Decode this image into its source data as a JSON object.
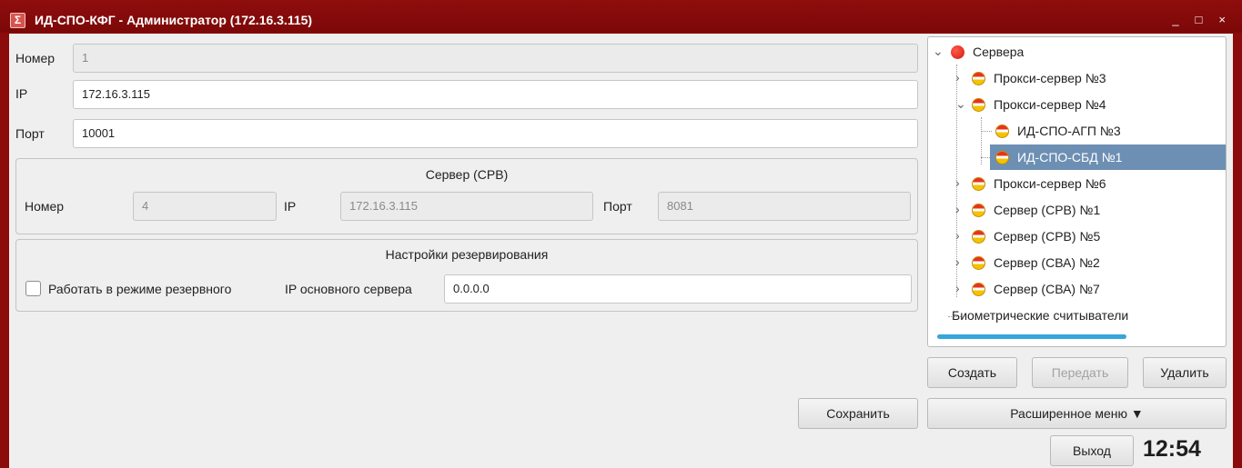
{
  "window": {
    "title": "ИД-СПО-КФГ - Администратор  (172.16.3.115)",
    "minimize": "_",
    "maximize": "□",
    "close": "×"
  },
  "form": {
    "number_label": "Номер",
    "number_value": "1",
    "ip_label": "IP",
    "ip_value": "172.16.3.115",
    "port_label": "Порт",
    "port_value": "10001"
  },
  "server_group": {
    "title": "Сервер (СРВ)",
    "number_label": "Номер",
    "number_value": "4",
    "ip_label": "IP",
    "ip_value": "172.16.3.115",
    "port_label": "Порт",
    "port_value": "8081"
  },
  "reserve_group": {
    "title": "Настройки резервирования",
    "checkbox_label": "Работать в режиме резервного",
    "checkbox_checked": false,
    "main_ip_label": "IP основного сервера",
    "main_ip_value": "0.0.0.0"
  },
  "tree": {
    "items": [
      {
        "label": "Сервера",
        "icon": "red-circle-icon",
        "expanded": true
      },
      {
        "label": "Прокси-сервер №3",
        "icon": "server-status-icon",
        "expanded": false
      },
      {
        "label": "Прокси-сервер №4",
        "icon": "server-status-icon",
        "expanded": true
      },
      {
        "label": "ИД-СПО-АГП №3",
        "icon": "server-status-icon"
      },
      {
        "label": "ИД-СПО-СБД №1",
        "icon": "server-status-icon",
        "selected": true
      },
      {
        "label": "Прокси-сервер №6",
        "icon": "server-status-icon",
        "expanded": false
      },
      {
        "label": "Сервер (СРВ) №1",
        "icon": "server-status-icon",
        "expanded": false
      },
      {
        "label": "Сервер (СРВ) №5",
        "icon": "server-status-icon",
        "expanded": false
      },
      {
        "label": "Сервер (СВА) №2",
        "icon": "server-status-icon",
        "expanded": false
      },
      {
        "label": "Сервер (СВА) №7",
        "icon": "server-status-icon",
        "expanded": false
      },
      {
        "label": "Биометрические считыватели"
      }
    ]
  },
  "buttons": {
    "create": "Создать",
    "send": "Передать",
    "delete": "Удалить",
    "save": "Сохранить",
    "advanced_menu": "Расширенное меню ▼",
    "exit": "Выход"
  },
  "clock": "12:54",
  "colors": {
    "window_frame": "#8c0b0b",
    "selection": "#6d8fb3",
    "scrollbar": "#35a6db"
  }
}
